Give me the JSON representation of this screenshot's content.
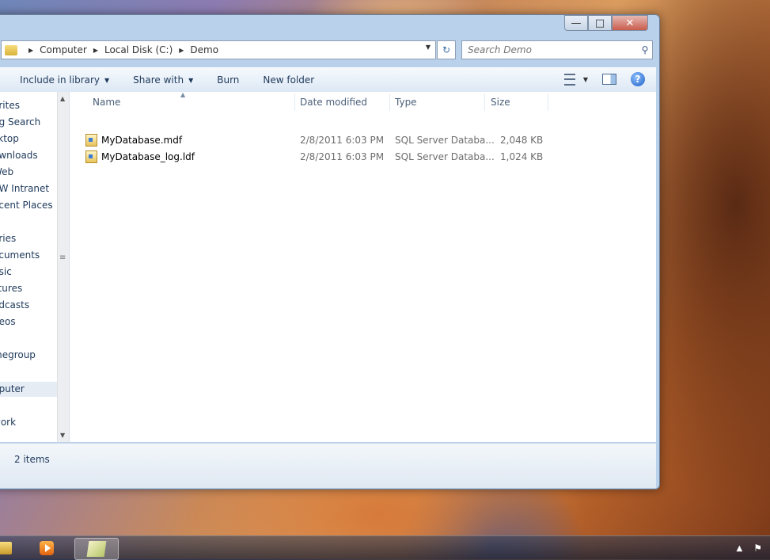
{
  "window": {
    "caption_buttons": {
      "minimize": "—",
      "maximize": "□",
      "close": "✕"
    }
  },
  "address_bar": {
    "crumbs": [
      "Computer",
      "Local Disk (C:)",
      "Demo"
    ]
  },
  "search": {
    "placeholder": "Search Demo"
  },
  "toolbar": {
    "include_in_library": "Include in library",
    "share_with": "Share with",
    "burn": "Burn",
    "new_folder": "New folder"
  },
  "nav_pane": {
    "items": [
      "orites",
      "ng Search",
      "sktop",
      "ownloads",
      "Web",
      "SW Intranet",
      "ecent Places",
      "aries",
      "ocuments",
      "usic",
      "ctures",
      "odcasts",
      "deos",
      "megroup",
      "nputer",
      "work"
    ]
  },
  "columns": {
    "name": "Name",
    "date_modified": "Date modified",
    "type": "Type",
    "size": "Size"
  },
  "files": [
    {
      "name": "MyDatabase.mdf",
      "date": "2/8/2011 6:03 PM",
      "type": "SQL Server Databa...",
      "size": "2,048 KB"
    },
    {
      "name": "MyDatabase_log.ldf",
      "date": "2/8/2011 6:03 PM",
      "type": "SQL Server Databa...",
      "size": "1,024 KB"
    }
  ],
  "status": {
    "item_count": "2 items"
  },
  "icons": {
    "folder": "folder-icon",
    "refresh": "refresh-icon",
    "search": "search-icon",
    "view": "view-options-icon",
    "preview_pane": "preview-pane-icon",
    "help": "help-icon",
    "database_file": "database-file-icon"
  }
}
